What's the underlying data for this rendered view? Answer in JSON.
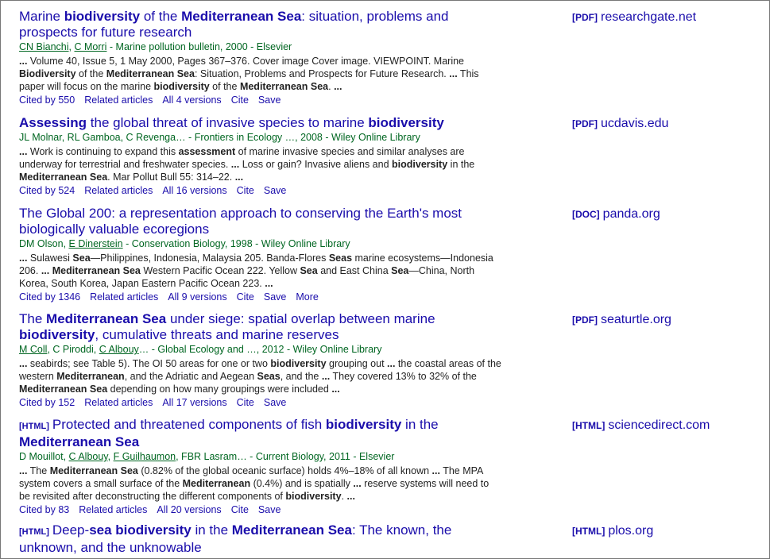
{
  "results": [
    {
      "title": [
        {
          "t": "Marine "
        },
        {
          "t": "biodiversity",
          "b": true
        },
        {
          "t": " of the "
        },
        {
          "t": "Mediterranean Sea",
          "b": true
        },
        {
          "t": ": situation, problems and prospects for future research"
        }
      ],
      "meta": [
        {
          "t": "CN Bianchi",
          "u": true
        },
        {
          "t": ", "
        },
        {
          "t": "C Morri",
          "u": true
        },
        {
          "t": " - Marine pollution bulletin, 2000 - Elsevier"
        }
      ],
      "snippet": [
        {
          "t": "...",
          "b": true
        },
        {
          "t": " Volume 40, Issue 5, 1 May 2000, Pages 367–376. Cover image Cover image. VIEWPOINT. Marine "
        },
        {
          "t": "Biodiversity",
          "b": true
        },
        {
          "t": " of the "
        },
        {
          "t": "Mediterranean Sea",
          "b": true
        },
        {
          "t": ": Situation, Problems and Prospects for Future Research. "
        },
        {
          "t": "...",
          "b": true
        },
        {
          "t": " This paper will focus on the marine "
        },
        {
          "t": "biodiversity",
          "b": true
        },
        {
          "t": " of the "
        },
        {
          "t": "Mediterranean Sea",
          "b": true
        },
        {
          "t": ". "
        },
        {
          "t": "...",
          "b": true
        }
      ],
      "links": [
        "Cited by 550",
        "Related articles",
        "All 4 versions",
        "Cite",
        "Save"
      ],
      "side_tag": "[PDF]",
      "side_site": "researchgate.net"
    },
    {
      "title": [
        {
          "t": "Assessing",
          "b": true
        },
        {
          "t": " the global threat of invasive species to marine "
        },
        {
          "t": "biodiversity",
          "b": true
        }
      ],
      "meta": [
        {
          "t": "JL Molnar, RL Gamboa, C Revenga… - Frontiers in Ecology …, 2008 - Wiley Online Library"
        }
      ],
      "snippet": [
        {
          "t": "...",
          "b": true
        },
        {
          "t": " Work is continuing to expand this "
        },
        {
          "t": "assessment",
          "b": true
        },
        {
          "t": " of marine invasive species and similar analyses are underway for terrestrial and freshwater species. "
        },
        {
          "t": "...",
          "b": true
        },
        {
          "t": " Loss or gain? Invasive aliens and "
        },
        {
          "t": "biodiversity",
          "b": true
        },
        {
          "t": " in the "
        },
        {
          "t": "Mediterranean Sea",
          "b": true
        },
        {
          "t": ". Mar Pollut Bull 55: 314–22. "
        },
        {
          "t": "...",
          "b": true
        }
      ],
      "links": [
        "Cited by 524",
        "Related articles",
        "All 16 versions",
        "Cite",
        "Save"
      ],
      "side_tag": "[PDF]",
      "side_site": "ucdavis.edu"
    },
    {
      "title": [
        {
          "t": "The Global 200: a representation approach to conserving the Earth's most biologically valuable ecoregions"
        }
      ],
      "meta": [
        {
          "t": "DM Olson, "
        },
        {
          "t": "E Dinerstein",
          "u": true
        },
        {
          "t": " - Conservation Biology, 1998 - Wiley Online Library"
        }
      ],
      "snippet": [
        {
          "t": "...",
          "b": true
        },
        {
          "t": " Sulawesi "
        },
        {
          "t": "Sea",
          "b": true
        },
        {
          "t": "—Philippines, Indonesia, Malaysia 205. Banda-Flores "
        },
        {
          "t": "Seas",
          "b": true
        },
        {
          "t": " marine ecosystems—Indonesia 206. "
        },
        {
          "t": "...",
          "b": true
        },
        {
          "t": " "
        },
        {
          "t": "Mediterranean Sea",
          "b": true
        },
        {
          "t": " Western Pacific Ocean 222. Yellow "
        },
        {
          "t": "Sea",
          "b": true
        },
        {
          "t": " and East China "
        },
        {
          "t": "Sea",
          "b": true
        },
        {
          "t": "—China, North Korea, South Korea, Japan Eastern Pacific Ocean 223. "
        },
        {
          "t": "...",
          "b": true
        }
      ],
      "links": [
        "Cited by 1346",
        "Related articles",
        "All 9 versions",
        "Cite",
        "Save",
        "More"
      ],
      "side_tag": "[DOC]",
      "side_site": "panda.org"
    },
    {
      "title": [
        {
          "t": "The "
        },
        {
          "t": "Mediterranean Sea",
          "b": true
        },
        {
          "t": " under siege: spatial overlap between marine "
        },
        {
          "t": "biodiversity",
          "b": true
        },
        {
          "t": ", cumulative threats and marine reserves"
        }
      ],
      "meta": [
        {
          "t": "M Coll",
          "u": true
        },
        {
          "t": ", C Piroddi, "
        },
        {
          "t": "C Albouy",
          "u": true
        },
        {
          "t": "… - Global Ecology and …, 2012 - Wiley Online Library"
        }
      ],
      "snippet": [
        {
          "t": "...",
          "b": true
        },
        {
          "t": " seabirds; see Table 5). The OI 50 areas for one or two "
        },
        {
          "t": "biodiversity",
          "b": true
        },
        {
          "t": " grouping out "
        },
        {
          "t": "...",
          "b": true
        },
        {
          "t": " the coastal areas of the western "
        },
        {
          "t": "Mediterranean",
          "b": true
        },
        {
          "t": ", and the Adriatic and Aegean "
        },
        {
          "t": "Seas",
          "b": true
        },
        {
          "t": ", and the "
        },
        {
          "t": "...",
          "b": true
        },
        {
          "t": " They covered 13% to 32% of the "
        },
        {
          "t": "Mediterranean Sea",
          "b": true
        },
        {
          "t": " depending on how many groupings were included "
        },
        {
          "t": "...",
          "b": true
        }
      ],
      "links": [
        "Cited by 152",
        "Related articles",
        "All 17 versions",
        "Cite",
        "Save"
      ],
      "side_tag": "[PDF]",
      "side_site": "seaturtle.org"
    },
    {
      "tag": "[HTML]",
      "title": [
        {
          "t": "Protected and threatened components of fish "
        },
        {
          "t": "biodiversity",
          "b": true
        },
        {
          "t": " in the "
        },
        {
          "t": "Mediterranean Sea",
          "b": true
        }
      ],
      "meta": [
        {
          "t": "D Mouillot, "
        },
        {
          "t": "C Albouy",
          "u": true
        },
        {
          "t": ", "
        },
        {
          "t": "F Guilhaumon",
          "u": true
        },
        {
          "t": ", FBR Lasram… - Current Biology, 2011 - Elsevier"
        }
      ],
      "snippet": [
        {
          "t": "...",
          "b": true
        },
        {
          "t": " The "
        },
        {
          "t": "Mediterranean Sea",
          "b": true
        },
        {
          "t": " (0.82% of the global oceanic surface) holds 4%–18% of all known "
        },
        {
          "t": "...",
          "b": true
        },
        {
          "t": " The MPA system covers a small surface of the "
        },
        {
          "t": "Mediterranean",
          "b": true
        },
        {
          "t": " (0.4%) and is spatially "
        },
        {
          "t": "...",
          "b": true
        },
        {
          "t": " reserve systems will need to be revisited after deconstructing the different components of "
        },
        {
          "t": "biodiversity",
          "b": true
        },
        {
          "t": ". "
        },
        {
          "t": "...",
          "b": true
        }
      ],
      "links": [
        "Cited by 83",
        "Related articles",
        "All 20 versions",
        "Cite",
        "Save"
      ],
      "side_tag": "[HTML]",
      "side_site": "sciencedirect.com"
    },
    {
      "tag": "[HTML]",
      "title": [
        {
          "t": "Deep-"
        },
        {
          "t": "sea",
          "b": true
        },
        {
          "t": " "
        },
        {
          "t": "biodiversity",
          "b": true
        },
        {
          "t": " in the "
        },
        {
          "t": "Mediterranean Sea",
          "b": true
        },
        {
          "t": ": The known, the unknown, and the unknowable"
        }
      ],
      "meta": [],
      "snippet": [],
      "links": [],
      "side_tag": "[HTML]",
      "side_site": "plos.org"
    }
  ]
}
